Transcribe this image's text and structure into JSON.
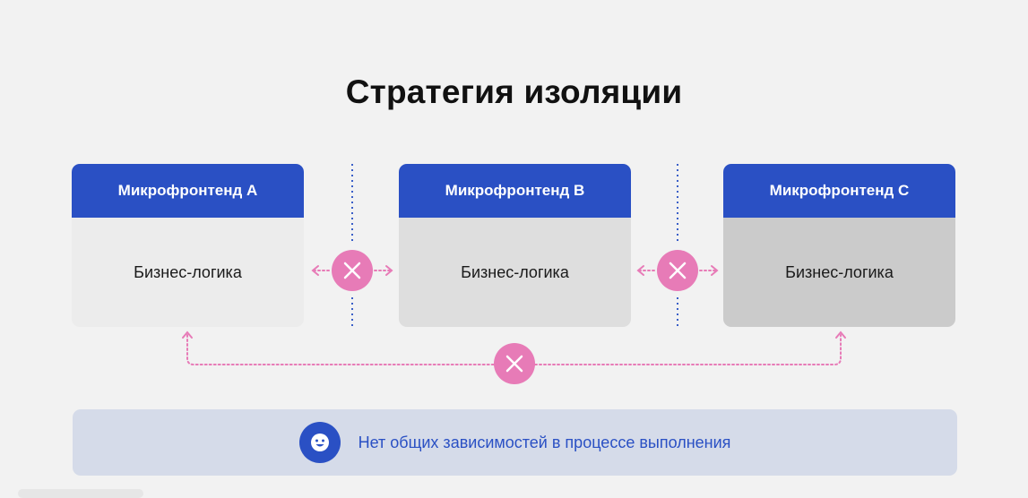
{
  "title": "Стратегия изоляции",
  "microfrontends": [
    {
      "header": "Микрофронтенд A",
      "body": "Бизнес-логика"
    },
    {
      "header": "Микрофронтенд B",
      "body": "Бизнес-логика"
    },
    {
      "header": "Микрофронтенд C",
      "body": "Бизнес-логика"
    }
  ],
  "banner": {
    "text": "Нет общих зависимостей в процессе выполнения",
    "icon": "smile-icon"
  },
  "colors": {
    "header_blue": "#2a50c4",
    "blocked_pink": "#e77bb7",
    "separator_blue": "#3a5fc8",
    "banner_bg": "#d5dbe9"
  }
}
